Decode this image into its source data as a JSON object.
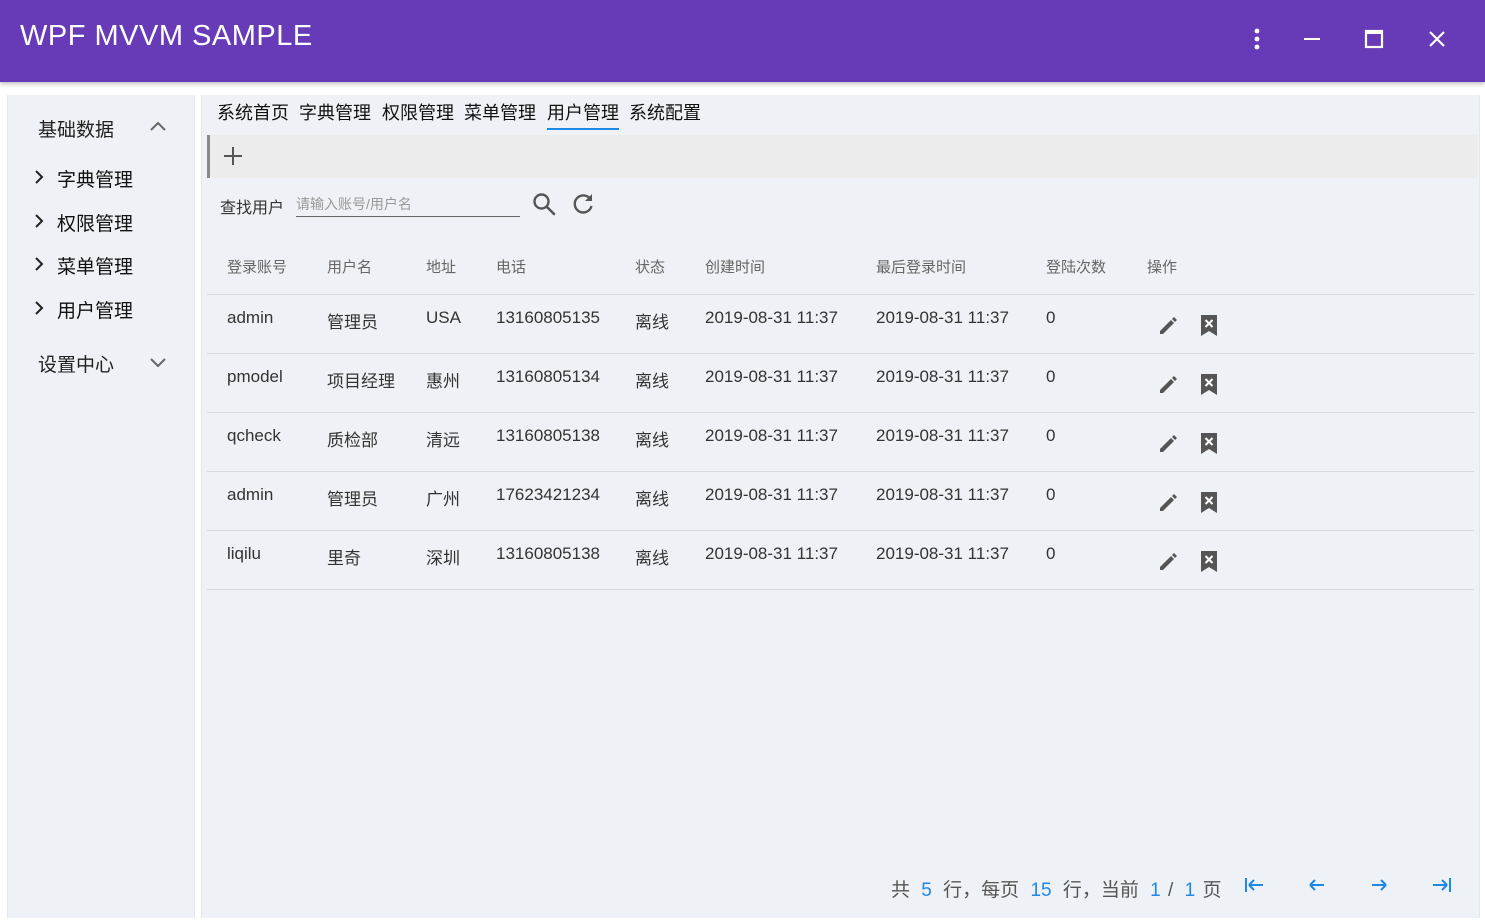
{
  "window": {
    "title": "WPF MVVM SAMPLE",
    "menu_icon": "more-vert-icon",
    "minimize_icon": "minimize-icon",
    "maximize_icon": "maximize-icon",
    "close_icon": "close-icon"
  },
  "sidebar": {
    "groups": [
      {
        "label": "基础数据",
        "expanded": true,
        "items": [
          {
            "label": "字典管理"
          },
          {
            "label": "权限管理"
          },
          {
            "label": "菜单管理"
          },
          {
            "label": "用户管理"
          }
        ]
      },
      {
        "label": "设置中心",
        "expanded": false,
        "items": []
      }
    ]
  },
  "tabs": [
    {
      "label": "系统首页",
      "active": false
    },
    {
      "label": "字典管理",
      "active": false
    },
    {
      "label": "权限管理",
      "active": false
    },
    {
      "label": "菜单管理",
      "active": false
    },
    {
      "label": "用户管理",
      "active": true
    },
    {
      "label": "系统配置",
      "active": false
    }
  ],
  "toolbar": {
    "add_icon": "plus-icon"
  },
  "search": {
    "label": "查找用户",
    "placeholder": "请输入账号/用户名",
    "value": "",
    "search_icon": "search-icon",
    "refresh_icon": "refresh-icon"
  },
  "table": {
    "headers": [
      "登录账号",
      "用户名",
      "地址",
      "电话",
      "状态",
      "创建时间",
      "最后登录时间",
      "登陆次数",
      "操作"
    ],
    "rows": [
      {
        "account": "admin",
        "name": "管理员",
        "address": "USA",
        "phone": "13160805135",
        "status": "离线",
        "created": "2019-08-31 11:37",
        "last_login": "2019-08-31 11:37",
        "logins": "0"
      },
      {
        "account": "pmodel",
        "name": "项目经理",
        "address": "惠州",
        "phone": "13160805134",
        "status": "离线",
        "created": "2019-08-31 11:37",
        "last_login": "2019-08-31 11:37",
        "logins": "0"
      },
      {
        "account": "qcheck",
        "name": "质检部",
        "address": "清远",
        "phone": "13160805138",
        "status": "离线",
        "created": "2019-08-31 11:37",
        "last_login": "2019-08-31 11:37",
        "logins": "0"
      },
      {
        "account": "admin",
        "name": "管理员",
        "address": "广州",
        "phone": "17623421234",
        "status": "离线",
        "created": "2019-08-31 11:37",
        "last_login": "2019-08-31 11:37",
        "logins": "0"
      },
      {
        "account": "liqilu",
        "name": "里奇",
        "address": "深圳",
        "phone": "13160805138",
        "status": "离线",
        "created": "2019-08-31 11:37",
        "last_login": "2019-08-31 11:37",
        "logins": "0"
      }
    ],
    "edit_icon": "pencil-icon",
    "delete_icon": "bookmark-remove-icon"
  },
  "pager": {
    "prefix": "共",
    "total_rows": "5",
    "per_page_text": "行，每页",
    "page_size": "15",
    "current_text": "行，当前",
    "current_page": "1",
    "separator": "/",
    "total_pages": "1",
    "suffix": "页",
    "first_icon": "first-page-icon",
    "prev_icon": "arrow-left-icon",
    "next_icon": "arrow-right-icon",
    "last_icon": "last-page-icon"
  },
  "colors": {
    "accent": "#673ab7",
    "link": "#1e88e5",
    "panel": "#eef1f5"
  }
}
